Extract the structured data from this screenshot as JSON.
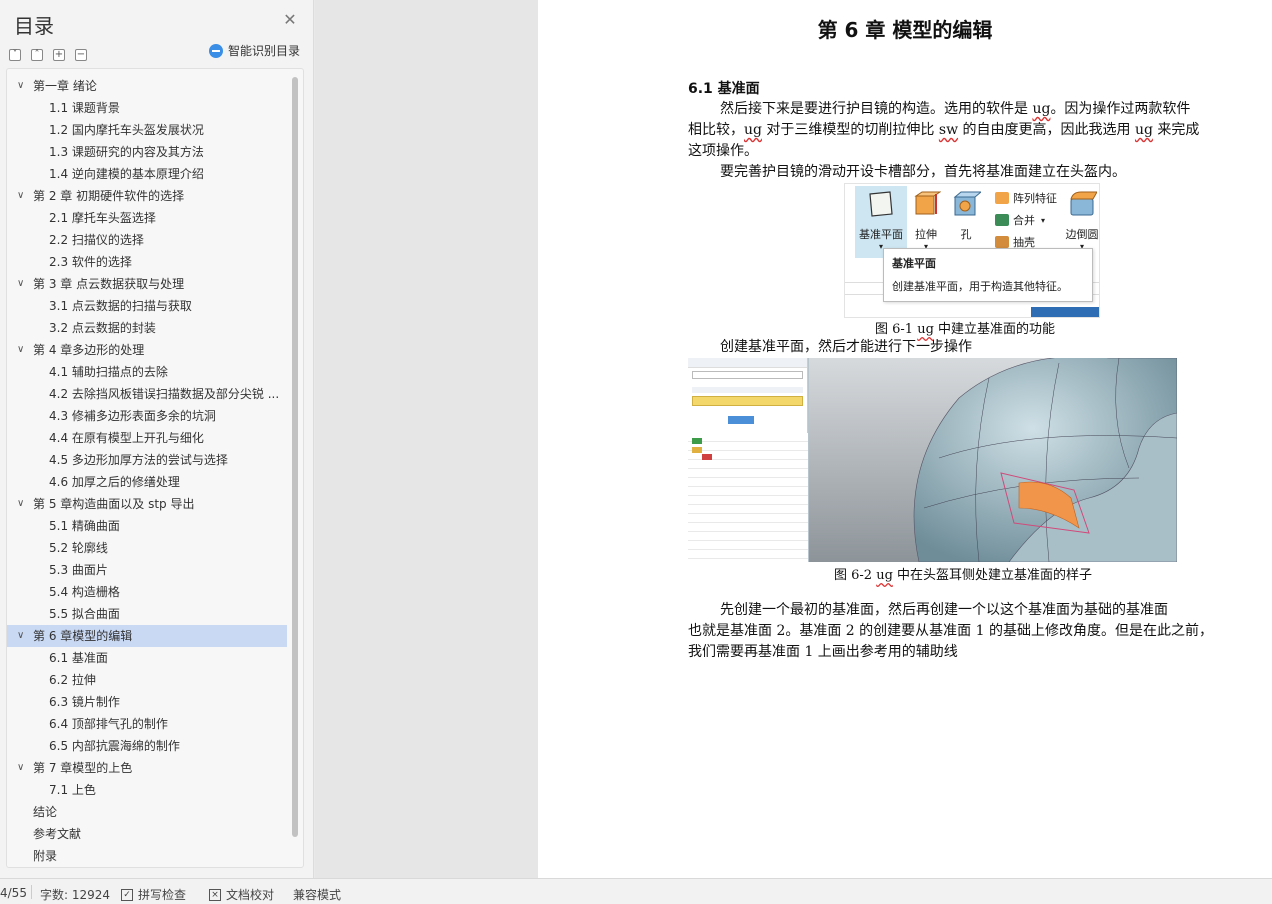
{
  "toc": {
    "title": "目录",
    "smart_label": "智能识别目录",
    "items": [
      {
        "label": "第一章  绪论",
        "level": 1
      },
      {
        "label": "1.1 课题背景",
        "level": 2
      },
      {
        "label": "1.2 国内摩托车头盔发展状况",
        "level": 2
      },
      {
        "label": "1.3 课题研究的内容及其方法",
        "level": 2
      },
      {
        "label": "1.4 逆向建模的基本原理介绍",
        "level": 2
      },
      {
        "label": "第 2 章  初期硬件软件的选择",
        "level": 1
      },
      {
        "label": "2.1 摩托车头盔选择",
        "level": 2
      },
      {
        "label": "2.2 扫描仪的选择",
        "level": 2
      },
      {
        "label": "2.3  软件的选择",
        "level": 2
      },
      {
        "label": "第 3 章    点云数据获取与处理",
        "level": 1
      },
      {
        "label": "3.1  点云数据的扫描与获取",
        "level": 2
      },
      {
        "label": "3.2  点云数据的封装",
        "level": 2
      },
      {
        "label": "第 4 章多边形的处理",
        "level": 1
      },
      {
        "label": "4.1  辅助扫描点的去除",
        "level": 2
      },
      {
        "label": "4.2  去除挡风板错误扫描数据及部分尖锐 ...",
        "level": 2
      },
      {
        "label": "4.3  修補多边形表面多余的坑洞",
        "level": 2
      },
      {
        "label": "4.4  在原有模型上开孔与细化",
        "level": 2
      },
      {
        "label": "4.5  多边形加厚方法的尝试与选择",
        "level": 2
      },
      {
        "label": "4.6  加厚之后的修缮处理",
        "level": 2
      },
      {
        "label": "第 5 章构造曲面以及 stp 导出",
        "level": 1
      },
      {
        "label": "5.1  精确曲面",
        "level": 2
      },
      {
        "label": "5.2  轮廓线",
        "level": 2
      },
      {
        "label": "5.3  曲面片",
        "level": 2
      },
      {
        "label": "5.4  构造栅格",
        "level": 2
      },
      {
        "label": "5.5  拟合曲面",
        "level": 2
      },
      {
        "label": "第 6 章模型的编辑",
        "level": 1,
        "active": true
      },
      {
        "label": "6.1  基准面",
        "level": 2
      },
      {
        "label": "6.2  拉伸",
        "level": 2
      },
      {
        "label": "6.3  镜片制作",
        "level": 2
      },
      {
        "label": "6.4  顶部排气孔的制作",
        "level": 2
      },
      {
        "label": "6.5  内部抗震海绵的制作",
        "level": 2
      },
      {
        "label": "第 7 章模型的上色",
        "level": 1
      },
      {
        "label": "7.1  上色",
        "level": 2
      },
      {
        "label": "结论",
        "level": 1,
        "nocaret": true
      },
      {
        "label": "参考文献",
        "level": 1,
        "nocaret": true
      },
      {
        "label": "附录",
        "level": 1,
        "nocaret": true
      }
    ]
  },
  "document": {
    "chapter_title": "第 6 章  模型的编辑",
    "section_heading": "6.1  基准面",
    "para1_line1_a": "然后接下来是要进行护目镜的构造。选用的软件是 ",
    "para1_ug1": "ug",
    "para1_line1_b": "。因为操作过两款软件",
    "para1_line2_a": "相比较，",
    "para1_ug2": "ug",
    "para1_line2_b": " 对于三维模型的切削拉伸比 ",
    "para1_sw": "sw",
    "para1_line2_c": " 的自由度更高，因此我选用 ",
    "para1_ug3": "ug",
    "para1_line2_d": " 来完成",
    "para1_line3": "这项操作。",
    "para2": "要完善护目镜的滑动开设卡槽部分，首先将基准面建立在头盔内。",
    "fig1_caption_a": "图 6-1 ",
    "fig1_caption_ug": "ug",
    "fig1_caption_b": " 中建立基准面的功能",
    "para3": "创建基准平面，然后才能进行下一步操作",
    "fig2_caption_a": "图 6-2 ",
    "fig2_caption_ug": "ug",
    "fig2_caption_b": " 中在头盔耳侧处建立基准面的样子",
    "para4_line1": "先创建一个最初的基准面，然后再创建一个以这个基准面为基础的基准面",
    "para4_line2": "也就是基准面 2。基准面 2 的创建要从基准面 1 的基础上修改角度。但是在此之前，",
    "para4_line3": "我们需要再基准面 1 上画出参考用的辅助线"
  },
  "ribbon": {
    "datum_label": "基准平面",
    "extrude_label": "拉伸",
    "hole_label": "孔",
    "pattern_label": "阵列特征",
    "union_label": "合并",
    "shell_label": "抽壳",
    "edge_label": "边倒圆",
    "tooltip_title": "基准平面",
    "tooltip_body": "创建基准平面，用于构造其他特征。"
  },
  "status": {
    "page": "4/55",
    "word_count": "字数: 12924",
    "spell_check": "拼写检查",
    "doc_proof": "文档校对",
    "compat_mode": "兼容模式"
  },
  "colors": {
    "toc_active": "#c9d9f4",
    "accent": "#3a8ee6",
    "highlight_orange": "#f0954a"
  }
}
